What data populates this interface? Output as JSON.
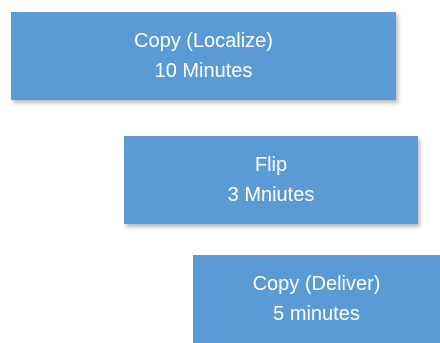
{
  "colors": {
    "box_fill": "#5b9bd5",
    "box_text": "#ffffff",
    "background": "#ffffff"
  },
  "steps": [
    {
      "name": "Copy (Localize)",
      "duration": "10 Minutes"
    },
    {
      "name": "Flip",
      "duration": "3 Mniutes"
    },
    {
      "name": "Copy (Deliver)",
      "duration": "5 minutes"
    }
  ]
}
